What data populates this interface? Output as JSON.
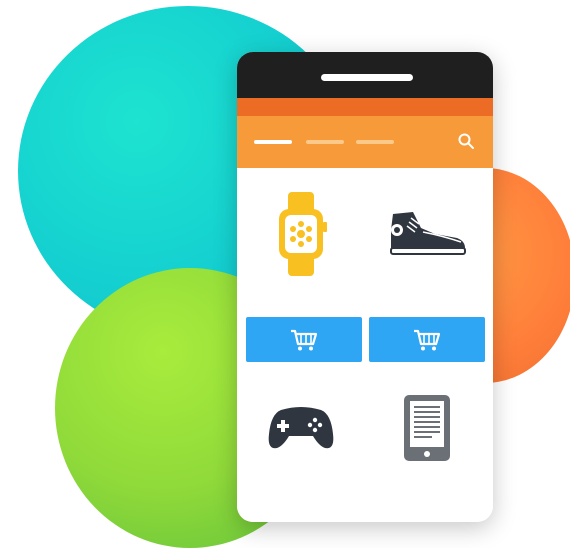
{
  "colors": {
    "teal": "#14cfd0",
    "orange": "#ff7f3a",
    "green": "#8fd93a",
    "phone_frame": "#1f1f1f",
    "status_bar": "#ed6c25",
    "nav_bar": "#f79a3a",
    "cart_button": "#2ea6f4",
    "watch": "#f8c021",
    "dark_icon": "#2f3640"
  },
  "nav": {
    "tabs": [
      "tab-1",
      "tab-2",
      "tab-3"
    ],
    "active_tab": 0,
    "icon": "search-icon"
  },
  "products": [
    {
      "icon": "smartwatch-icon"
    },
    {
      "icon": "sneaker-icon"
    },
    {
      "icon": "gamepad-icon"
    },
    {
      "icon": "ereader-icon"
    }
  ],
  "cart_buttons": [
    {
      "icon": "shopping-cart-icon"
    },
    {
      "icon": "shopping-cart-icon"
    }
  ]
}
